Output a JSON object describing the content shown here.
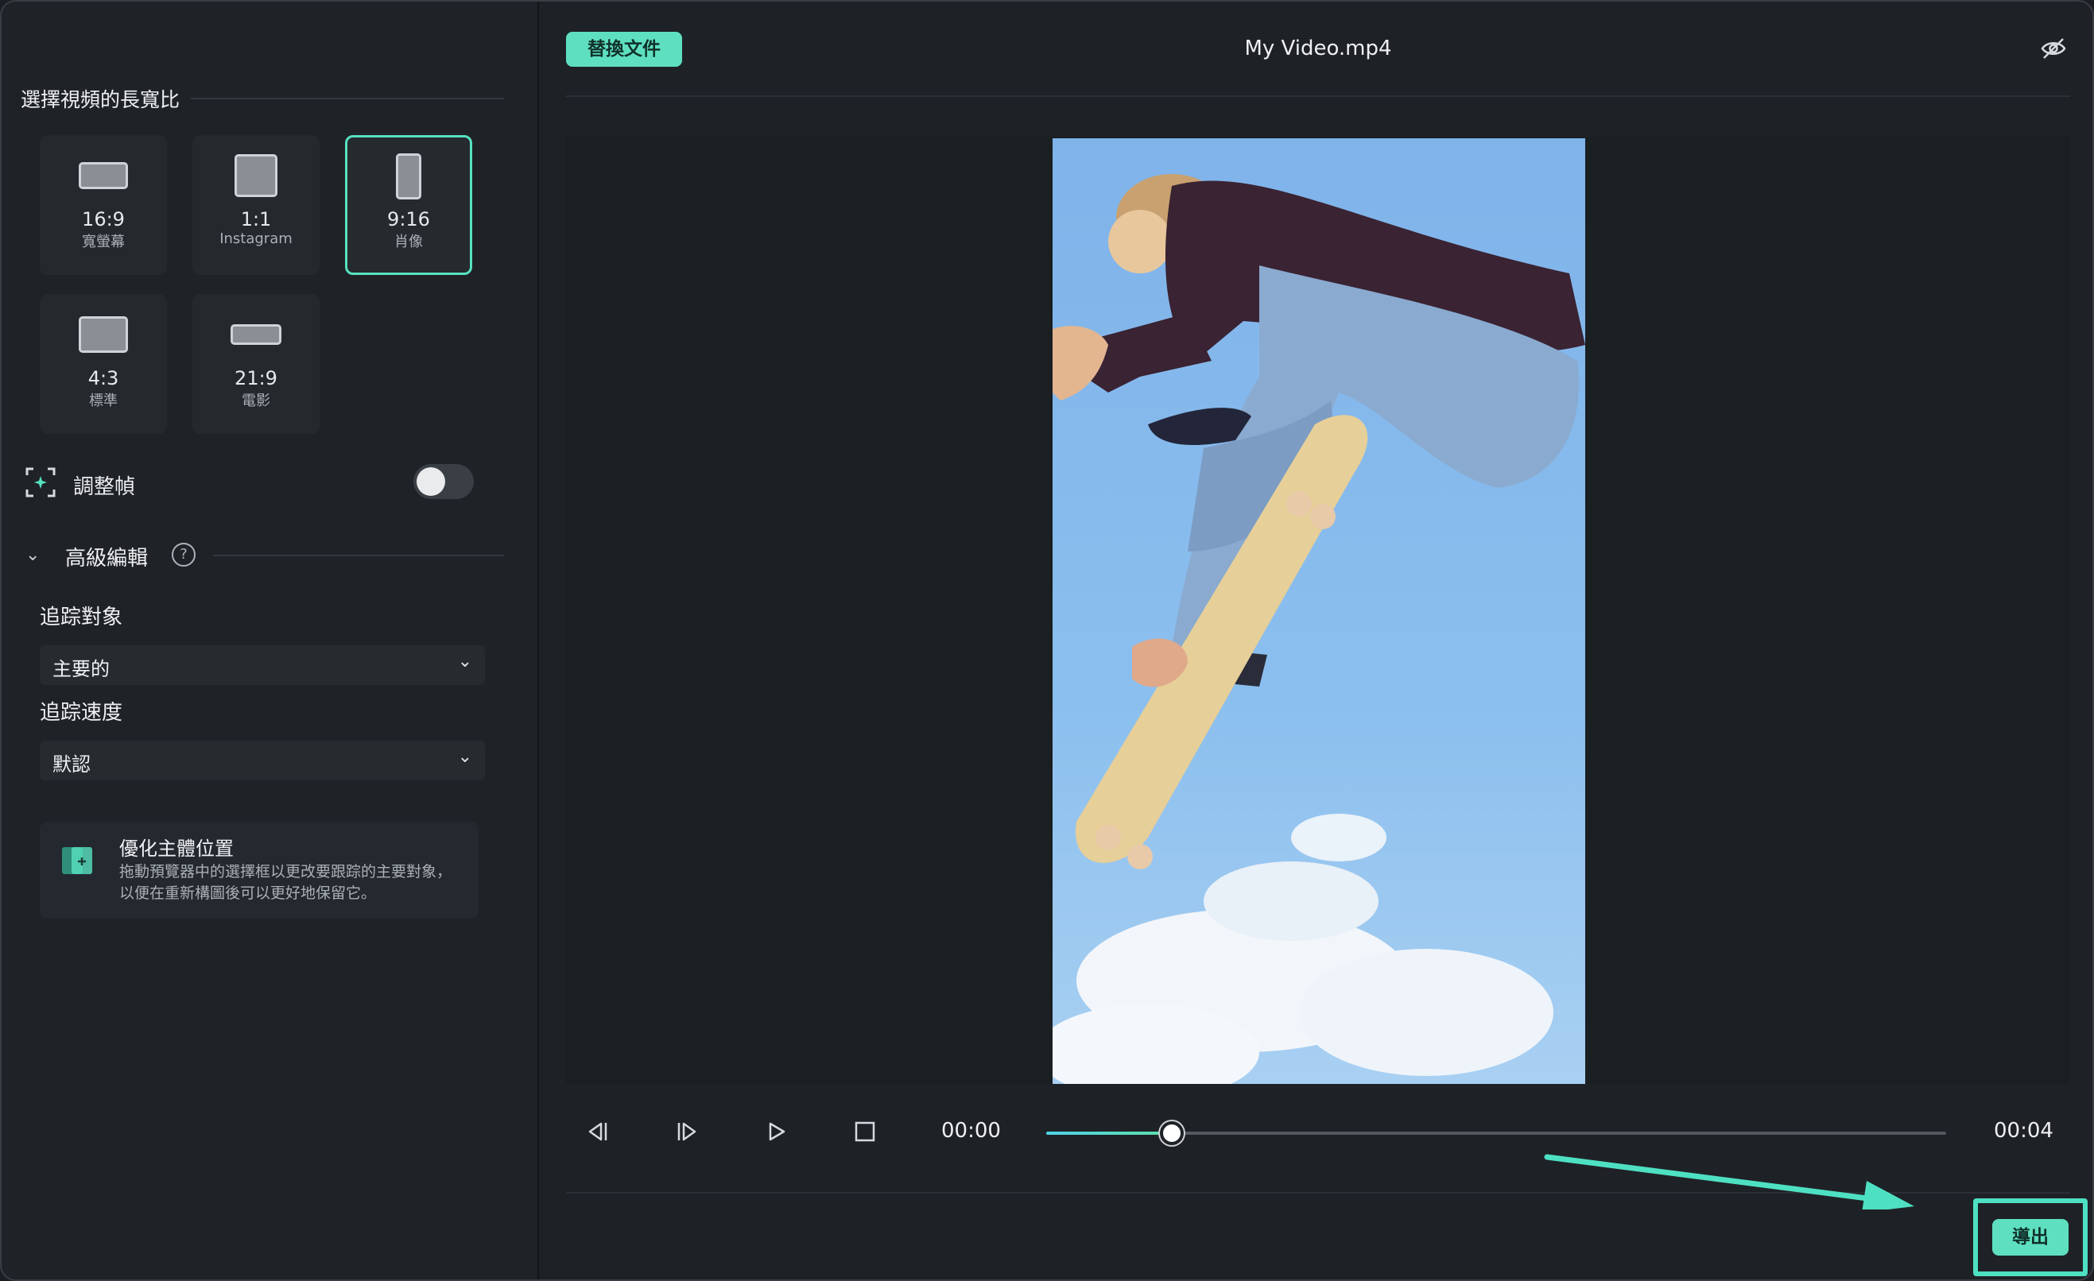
{
  "window": {
    "file_name": "My Video.mp4"
  },
  "left_panel": {
    "aspect_title": "選擇視頻的長寬比",
    "ratios": [
      {
        "title": "16:9",
        "sub": "寬螢幕"
      },
      {
        "title": "1:1",
        "sub": "Instagram"
      },
      {
        "title": "9:16",
        "sub": "肖像",
        "selected": true
      },
      {
        "title": "4:3",
        "sub": "標準"
      },
      {
        "title": "21:9",
        "sub": "電影"
      }
    ],
    "adjust_frame": {
      "label": "調整幀",
      "enabled": false
    },
    "advanced": {
      "label": "高級編輯",
      "track_target_label": "追踪對象",
      "track_target_value": "主要的",
      "track_speed_label": "追踪速度",
      "track_speed_value": "默認"
    },
    "tip": {
      "title": "優化主體位置",
      "desc": "拖動預覽器中的選擇框以更改要跟踪的主要對象，以便在重新構圖後可以更好地保留它。"
    }
  },
  "right_panel": {
    "replace_button": "替換文件",
    "current_time": "00:00",
    "total_time": "00:04",
    "progress": 0.14,
    "export_button": "導出"
  },
  "colors": {
    "accent": "#5ee0c0",
    "background": "#1e2227"
  },
  "icons": [
    "eye-off-icon",
    "prev-frame-icon",
    "next-frame-icon",
    "play-icon",
    "stop-icon",
    "frame-adjust-icon",
    "help-icon",
    "chevron-down-icon",
    "tip-icon"
  ]
}
